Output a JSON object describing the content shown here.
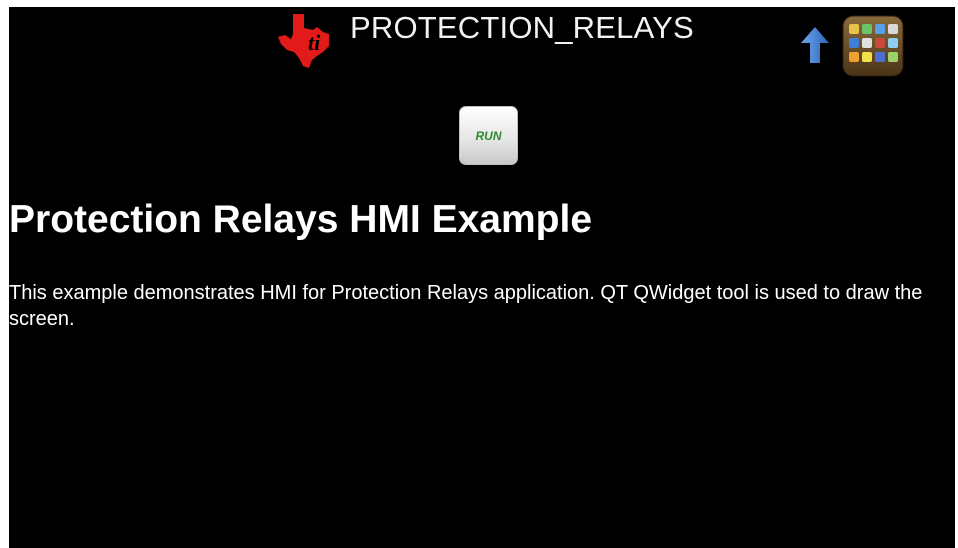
{
  "header": {
    "title": "PROTECTION_RELAYS",
    "logo_icon": "ti-texas-logo-icon",
    "up_icon": "up-arrow-icon",
    "apps_icon": "app-grid-icon"
  },
  "run_button": {
    "label": "RUN"
  },
  "main": {
    "heading": "Protection Relays HMI Example",
    "description": "This example demonstrates HMI for Protection Relays application. QT QWidget tool is used to draw the screen."
  },
  "colors": {
    "background": "#000000",
    "text": "#ffffff",
    "logo_red": "#e21a1a",
    "run_green": "#2f8a2f",
    "arrow_blue": "#3f7ed8"
  }
}
